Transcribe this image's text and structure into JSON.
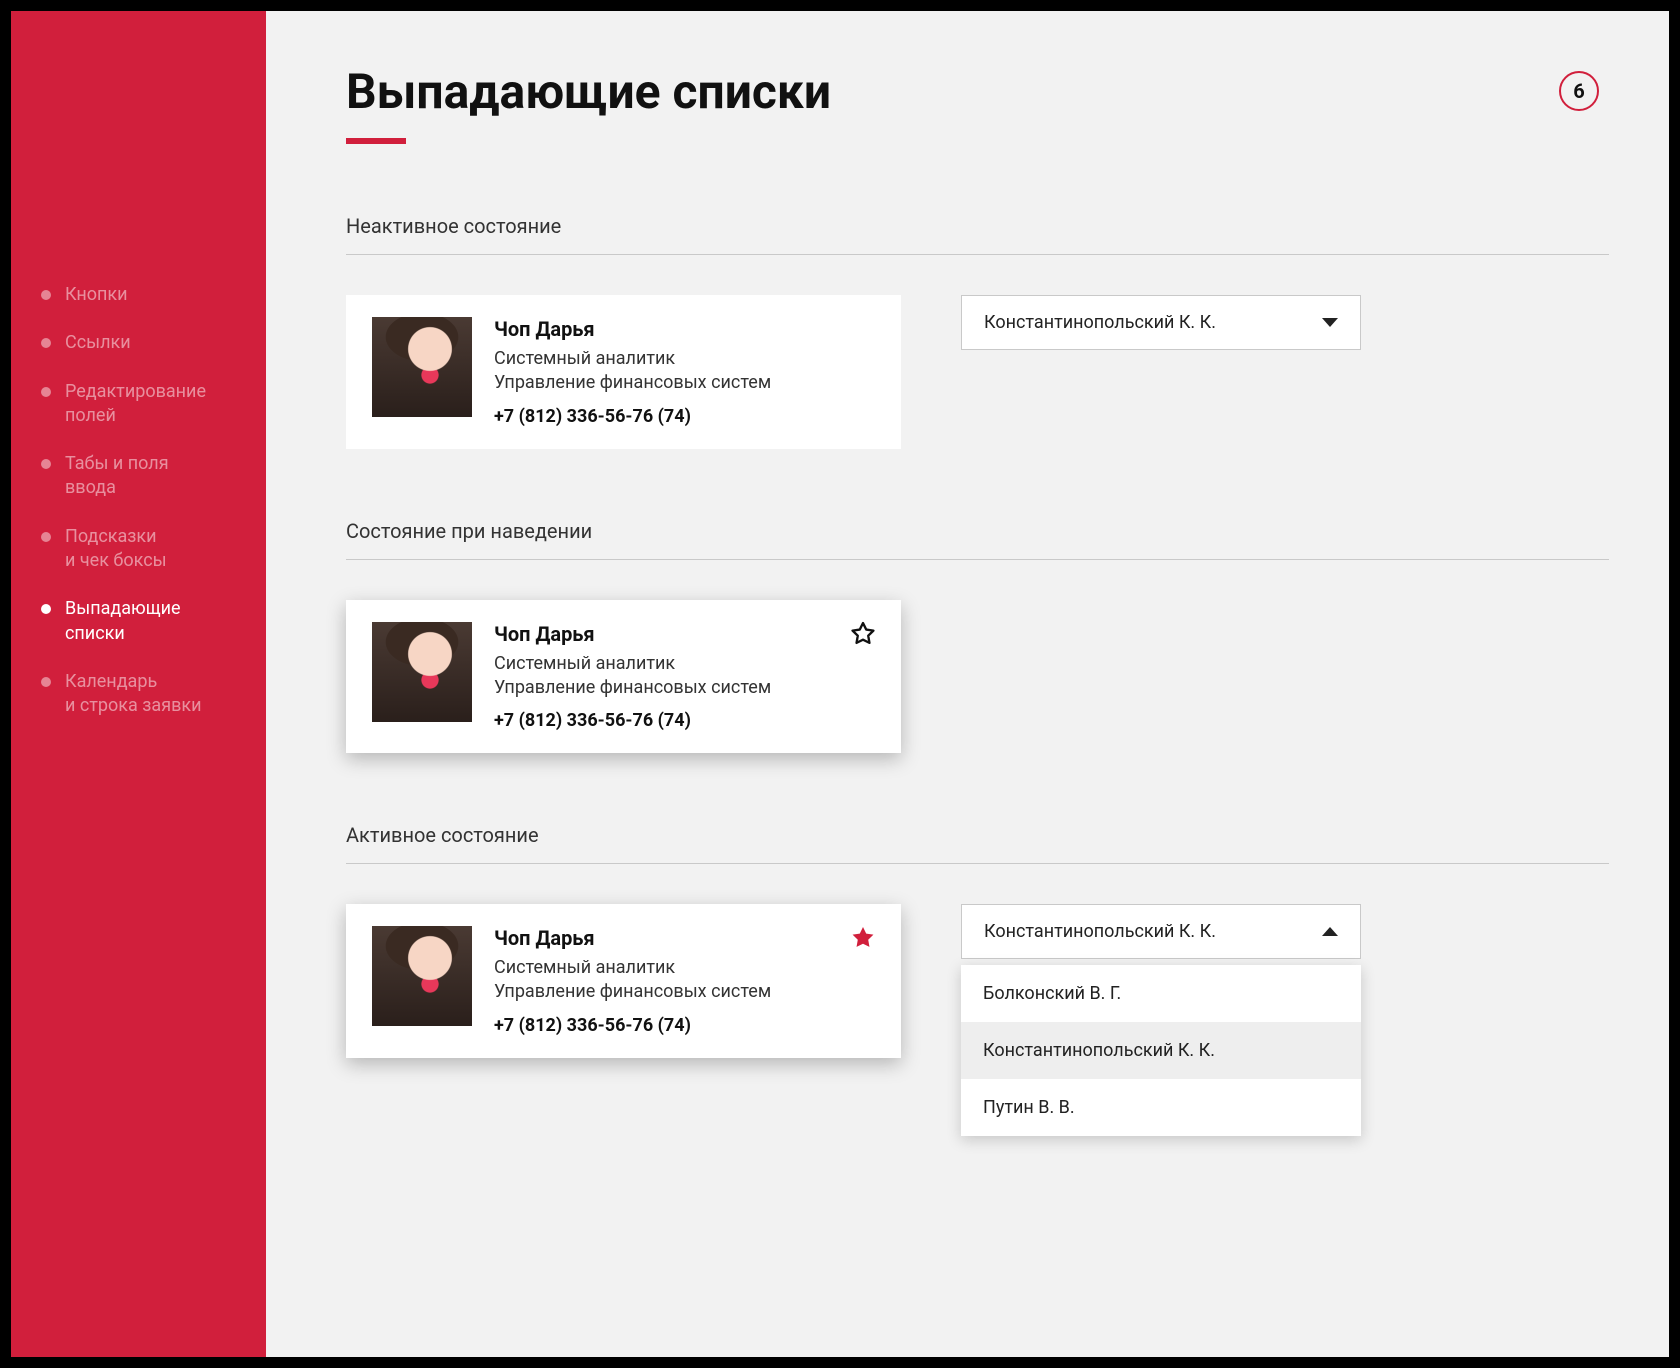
{
  "page": {
    "title": "Выпадающие списки",
    "badge": "6"
  },
  "sidebar": {
    "items": [
      {
        "label": "Кнопки",
        "active": false
      },
      {
        "label": "Ссылки",
        "active": false
      },
      {
        "label": "Редактирование\nполей",
        "active": false
      },
      {
        "label": "Табы и поля\nввода",
        "active": false
      },
      {
        "label": "Подсказки\nи чек боксы",
        "active": false
      },
      {
        "label": "Выпадающие\nсписки",
        "active": true
      },
      {
        "label": "Календарь\nи строка заявки",
        "active": false
      }
    ]
  },
  "sections": {
    "inactive": {
      "title": "Неактивное состояние"
    },
    "hover": {
      "title": "Состояние при наведении"
    },
    "active": {
      "title": "Активное состояние"
    }
  },
  "person": {
    "name": "Чоп Дарья",
    "role": "Системный аналитик",
    "dept": "Управление финансовых систем",
    "phone": "+7 (812) 336-56-76 (74)"
  },
  "dropdown": {
    "selected": "Константинопольский К. К.",
    "options": [
      "Болконский В. Г.",
      "Константинопольский К. К.",
      "Путин В. В."
    ],
    "highlighted_index": 1
  },
  "icons": {
    "star_outline": "star-outline-icon",
    "star_filled": "star-filled-icon",
    "caret_down": "caret-down-icon",
    "caret_up": "caret-up-icon"
  },
  "colors": {
    "brand": "#d11f3c",
    "bg": "#f2f2f2"
  }
}
